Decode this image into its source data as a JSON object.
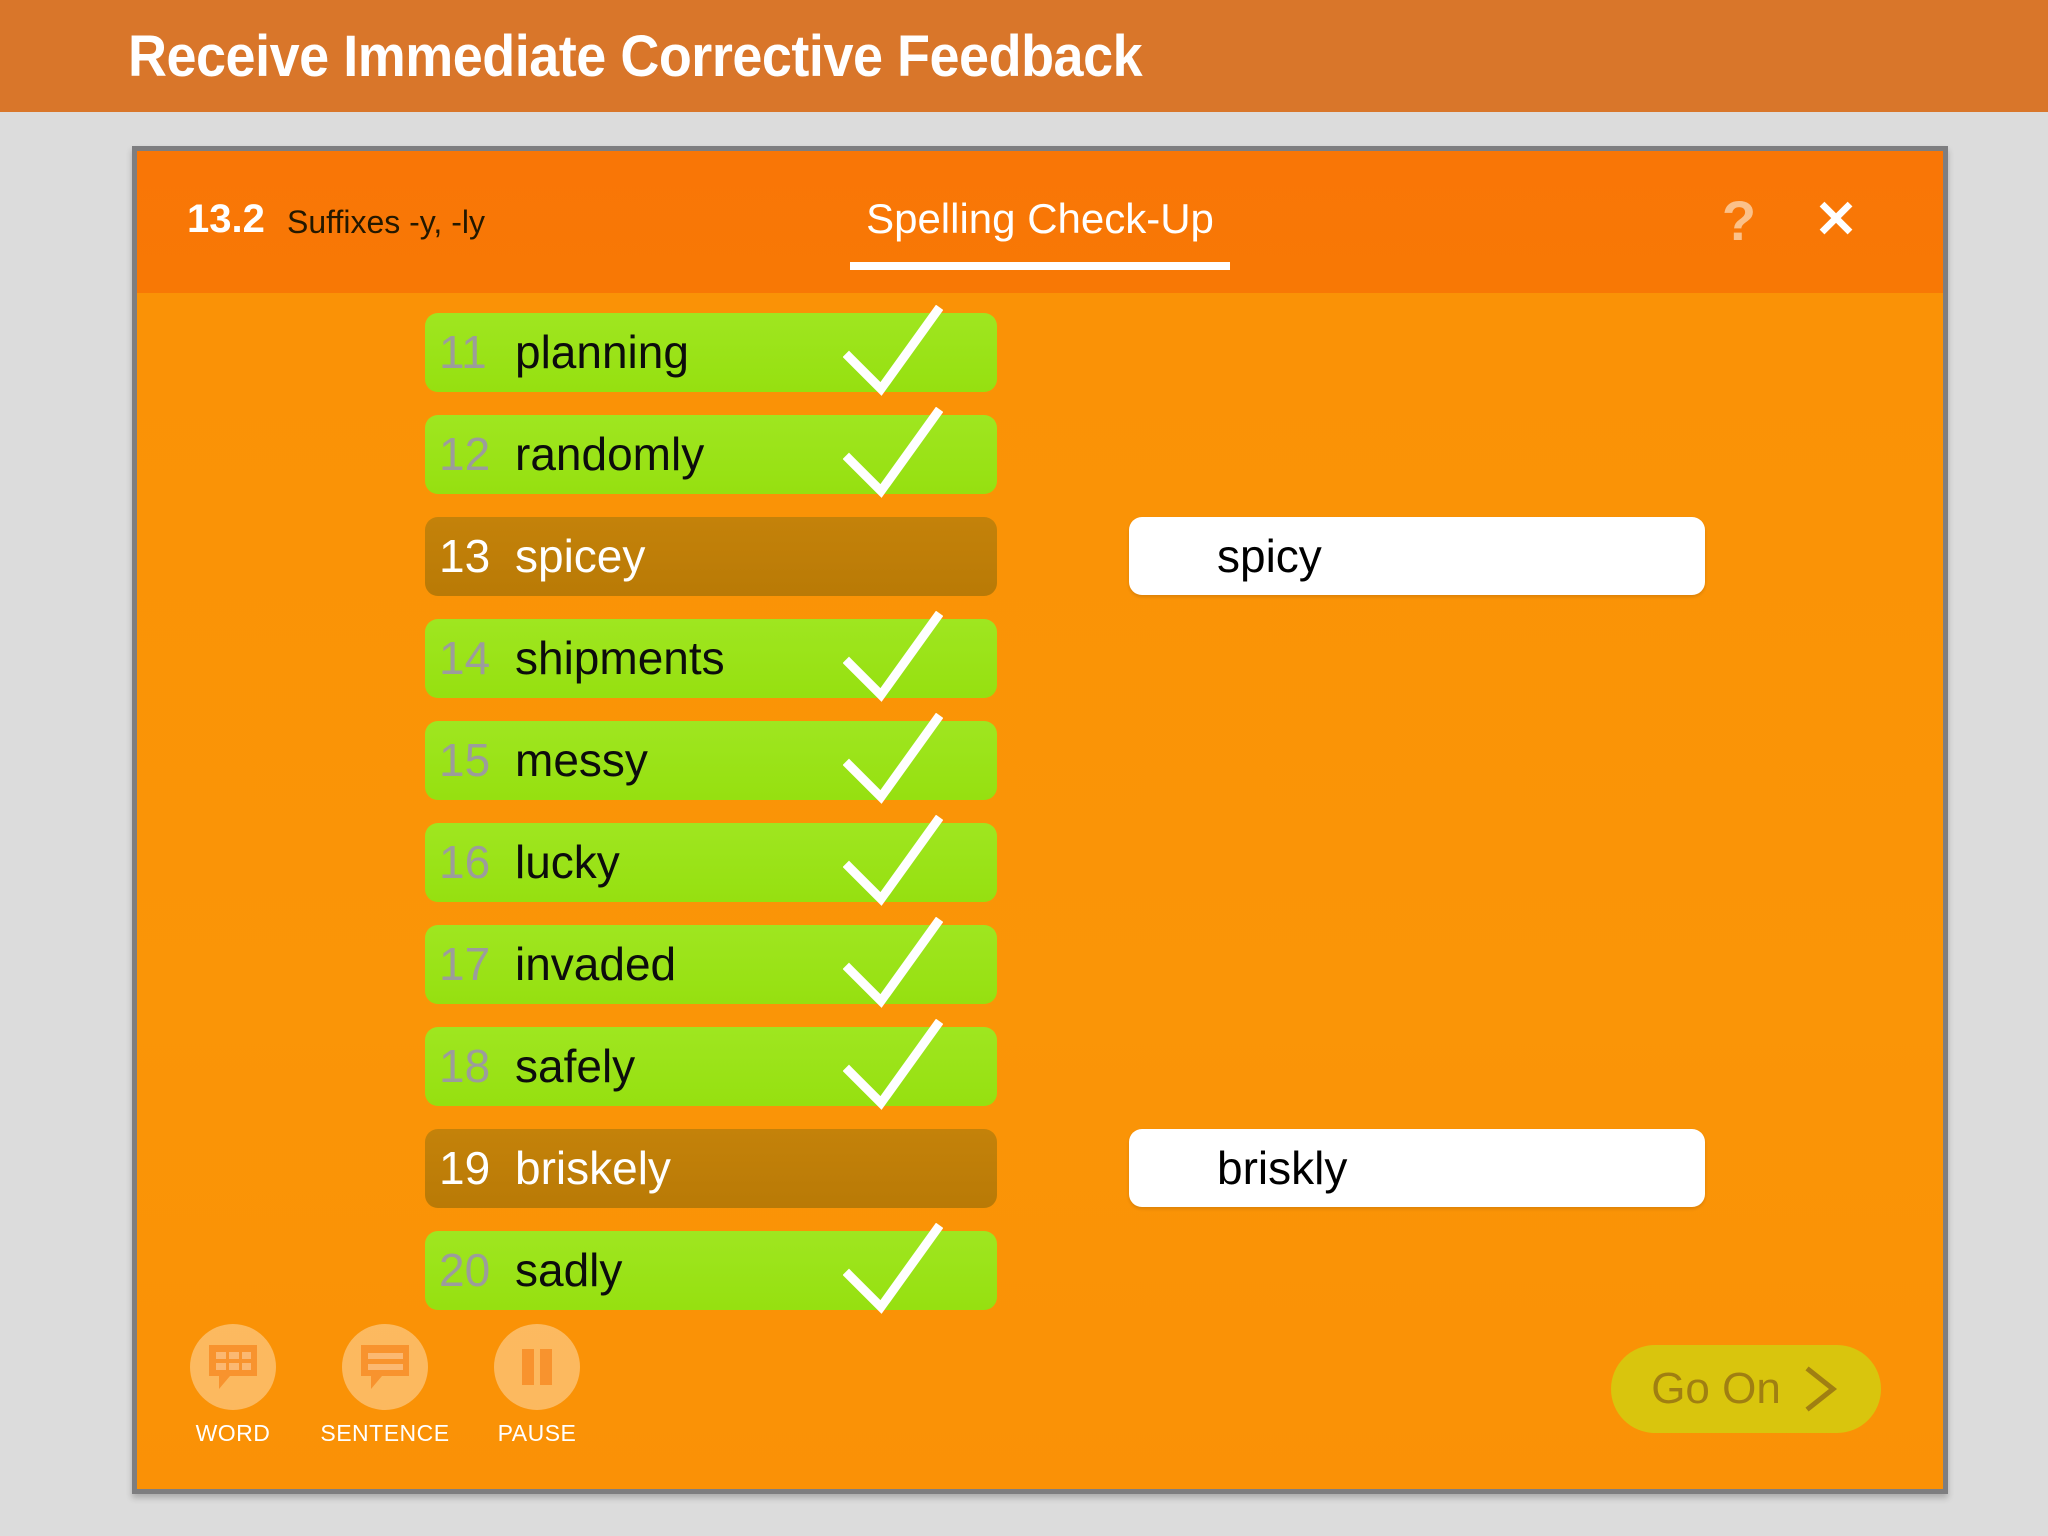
{
  "banner": {
    "title": "Receive Immediate Corrective Feedback",
    "bg_color": "#d9762a",
    "text_color": "#ffffff"
  },
  "page": {
    "bg_color": "#dcdcdc"
  },
  "window": {
    "border_color": "#7e7e80",
    "header_bg": "#f97606",
    "body_bg": "#fa9106",
    "lesson_number": "13.2",
    "lesson_name": "Suffixes -y, -ly",
    "activity_title": "Spelling Check-Up",
    "help_icon": "question-mark-icon",
    "help_label": "?",
    "close_icon": "close-icon",
    "close_label": "✕"
  },
  "word_list": {
    "correct_color": "#9fe620",
    "incorrect_color": "#c4820a",
    "check_color": "#ffffff",
    "rows": [
      {
        "index": "11",
        "word": "planning",
        "status": "correct",
        "correction": ""
      },
      {
        "index": "12",
        "word": "randomly",
        "status": "correct",
        "correction": ""
      },
      {
        "index": "13",
        "word": "spicey",
        "status": "incorrect",
        "correction": "spicy"
      },
      {
        "index": "14",
        "word": "shipments",
        "status": "correct",
        "correction": ""
      },
      {
        "index": "15",
        "word": "messy",
        "status": "correct",
        "correction": ""
      },
      {
        "index": "16",
        "word": "lucky",
        "status": "correct",
        "correction": ""
      },
      {
        "index": "17",
        "word": "invaded",
        "status": "correct",
        "correction": ""
      },
      {
        "index": "18",
        "word": "safely",
        "status": "correct",
        "correction": ""
      },
      {
        "index": "19",
        "word": "briskely",
        "status": "incorrect",
        "correction": "briskly"
      },
      {
        "index": "20",
        "word": "sadly",
        "status": "correct",
        "correction": ""
      }
    ]
  },
  "toolbar": {
    "buttons": [
      {
        "label": "WORD",
        "icon": "word-bubble-icon"
      },
      {
        "label": "SENTENCE",
        "icon": "sentence-bubble-icon"
      },
      {
        "label": "PAUSE",
        "icon": "pause-icon"
      }
    ]
  },
  "go_on": {
    "label": "Go On",
    "icon": "chevron-right-icon",
    "bg_color": "#d9c50d",
    "text_color": "#a07f12"
  }
}
